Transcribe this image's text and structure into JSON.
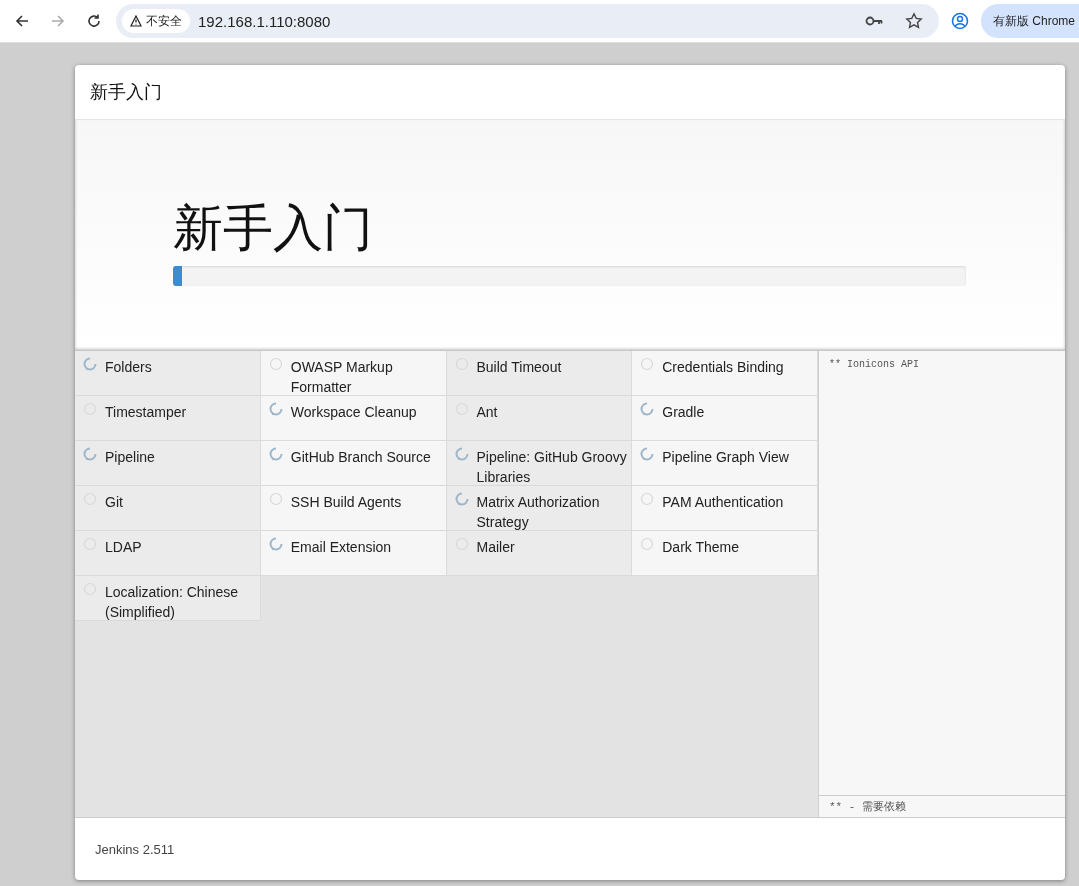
{
  "browser": {
    "security_label": "不安全",
    "url": "192.168.1.110:8080",
    "update_button": "有新版 Chrome",
    "forward_disabled": true
  },
  "dialog": {
    "title": "新手入门",
    "heading": "新手入门",
    "progress": {
      "level": 0.011
    },
    "plugins": [
      {
        "name": "Folders",
        "kind": "installing"
      },
      {
        "name": "OWASP Markup Formatter",
        "kind": "pending"
      },
      {
        "name": "Build Timeout",
        "kind": "pending"
      },
      {
        "name": "Credentials Binding",
        "kind": "pending"
      },
      {
        "name": "Timestamper",
        "kind": "pending"
      },
      {
        "name": "Workspace Cleanup",
        "kind": "installing"
      },
      {
        "name": "Ant",
        "kind": "pending"
      },
      {
        "name": "Gradle",
        "kind": "installing"
      },
      {
        "name": "Pipeline",
        "kind": "installing"
      },
      {
        "name": "GitHub Branch Source",
        "kind": "installing"
      },
      {
        "name": "Pipeline: GitHub Groovy Libraries",
        "kind": "installing"
      },
      {
        "name": "Pipeline Graph View",
        "kind": "installing"
      },
      {
        "name": "Git",
        "kind": "pending"
      },
      {
        "name": "SSH Build Agents",
        "kind": "pending"
      },
      {
        "name": "Matrix Authorization Strategy",
        "kind": "installing"
      },
      {
        "name": "PAM Authentication",
        "kind": "pending"
      },
      {
        "name": "LDAP",
        "kind": "pending"
      },
      {
        "name": "Email Extension",
        "kind": "installing"
      },
      {
        "name": "Mailer",
        "kind": "pending"
      },
      {
        "name": "Dark Theme",
        "kind": "pending"
      },
      {
        "name": "Localization: Chinese (Simplified)",
        "kind": "pending"
      }
    ],
    "log": {
      "lines": [
        "** Ionicons API"
      ],
      "legend": "** - 需要依赖"
    },
    "footer": "Jenkins 2.511"
  }
}
